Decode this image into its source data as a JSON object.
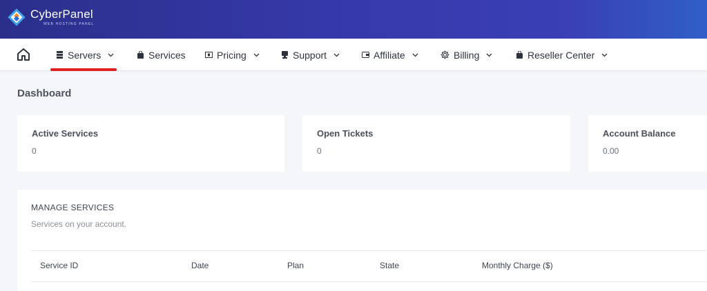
{
  "brand": {
    "name": "CyberPanel",
    "tagline": "WEB HOSTING PANEL"
  },
  "nav": {
    "home_icon": "home-icon",
    "items": [
      {
        "label": "Servers",
        "icon": "server-icon",
        "dropdown": true,
        "active": true
      },
      {
        "label": "Services",
        "icon": "bag-icon",
        "dropdown": false
      },
      {
        "label": "Pricing",
        "icon": "price-tag-icon",
        "dropdown": true
      },
      {
        "label": "Support",
        "icon": "support-icon",
        "dropdown": true
      },
      {
        "label": "Affiliate",
        "icon": "wallet-icon",
        "dropdown": true
      },
      {
        "label": "Billing",
        "icon": "gear-icon",
        "dropdown": true
      },
      {
        "label": "Reseller Center",
        "icon": "bag-icon",
        "dropdown": true
      }
    ],
    "active_color": "#e0201e"
  },
  "page": {
    "title": "Dashboard"
  },
  "stats": [
    {
      "label": "Active Services",
      "value": "0"
    },
    {
      "label": "Open Tickets",
      "value": "0"
    },
    {
      "label": "Account Balance",
      "value": "0.00"
    }
  ],
  "services": {
    "title": "MANAGE SERVICES",
    "subtitle": "Services on your account.",
    "columns": [
      "Service ID",
      "Date",
      "Plan",
      "State",
      "Monthly Charge ($)"
    ]
  },
  "colors": {
    "header_start": "#2b2f8a",
    "header_end": "#2f5fc8",
    "background": "#f5f6f9"
  }
}
